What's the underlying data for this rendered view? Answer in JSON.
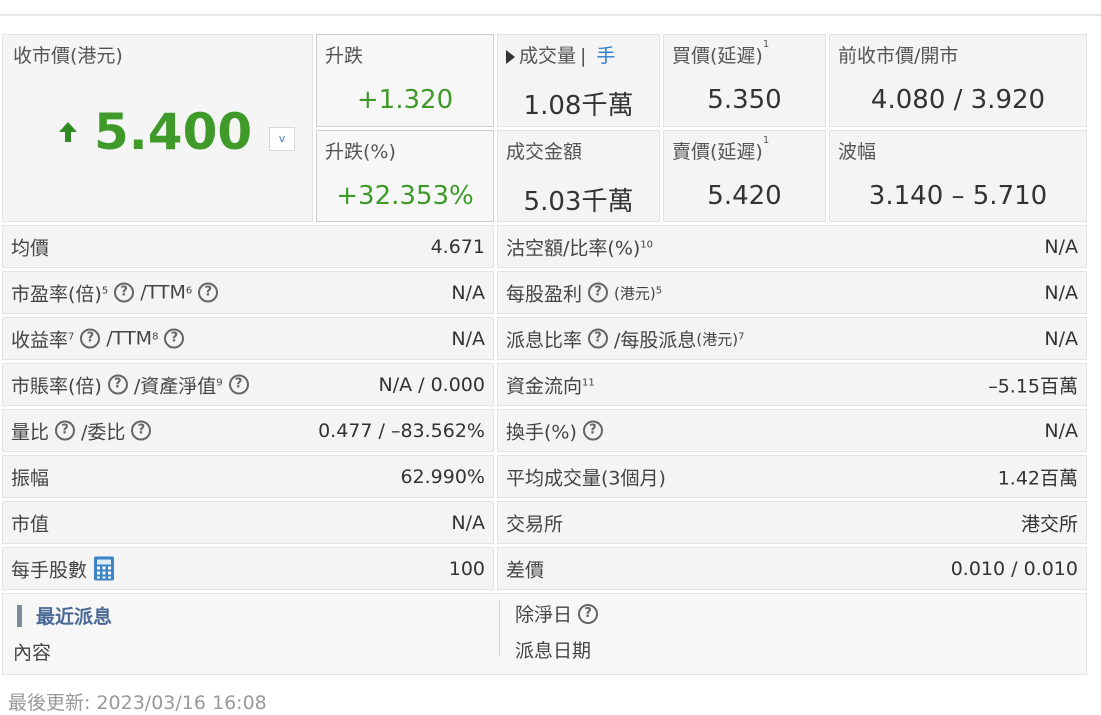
{
  "quote": {
    "close_label": "收市價(港元)",
    "price": "5.400",
    "price_dropdown": "v",
    "change_label": "升跌",
    "change_value": "+1.320",
    "change_pct_label": "升跌(%)",
    "change_pct_value": "+32.353%",
    "volume_label": "成交量",
    "volume_sep": "|",
    "volume_unit_link": "手",
    "volume_value": "1.08千萬",
    "turnover_label": "成交金額",
    "turnover_value": "5.03千萬",
    "bid_label": "買價(延遲)",
    "bid_sup": "1",
    "bid_value": "5.350",
    "ask_label": "賣價(延遲)",
    "ask_sup": "1",
    "ask_value": "5.420",
    "prev_open_label": "前收市價/開市",
    "prev_open_value": "4.080 / 3.920",
    "range_label": "波幅",
    "range_value": "3.140 – 5.710"
  },
  "stats": {
    "avg_price_label": "均價",
    "avg_price_value": "4.671",
    "short_label": "沽空額/比率(%)",
    "short_sup": "10",
    "short_value": "N/A",
    "pe_label": "市盈率(倍)",
    "pe_sup": "5",
    "pe_ttm_label": "/TTM",
    "pe_ttm_sup": "6",
    "pe_value": "N/A",
    "eps_label": "每股盈利",
    "eps_unit": "(港元)",
    "eps_sup": "5",
    "eps_value": "N/A",
    "yield_label": "收益率",
    "yield_sup": "7",
    "yield_ttm_label": "/TTM",
    "yield_ttm_sup": "8",
    "yield_value": "N/A",
    "payout_label": "派息比率",
    "payout_dps_label": "/每股派息",
    "payout_unit": "(港元)",
    "payout_sup": "7",
    "payout_value": "N/A",
    "pb_label": "市賬率(倍)",
    "pb_nav_label": "/資產淨值",
    "pb_sup": "9",
    "pb_value": "N/A / 0.000",
    "flow_label": "資金流向",
    "flow_sup": "11",
    "flow_value": "–5.15百萬",
    "vol_ratio_label": "量比",
    "bid_ratio_label": "/委比",
    "vol_ratio_value": "0.477 / –83.562%",
    "turnover_rate_label": "換手(%)",
    "turnover_rate_value": "N/A",
    "amplitude_label": "振幅",
    "amplitude_value": "62.990%",
    "avg_vol_label": "平均成交量(3個月)",
    "avg_vol_value": "1.42百萬",
    "mcap_label": "市值",
    "mcap_value": "N/A",
    "exchange_label": "交易所",
    "exchange_value": "港交所",
    "lot_label": "每手股數",
    "lot_value": "100",
    "spread_label": "差價",
    "spread_value": "0.010 / 0.010"
  },
  "dividend": {
    "title": "最近派息",
    "content_label": "內容",
    "ex_date_label": "除淨日",
    "pay_date_label": "派息日期"
  },
  "footer": {
    "updated": "最後更新: 2023/03/16 16:08"
  },
  "colors": {
    "up_green": "#3f9a2a",
    "link_blue": "#2a7bd1",
    "cell_bg": "#f4f4f4"
  }
}
